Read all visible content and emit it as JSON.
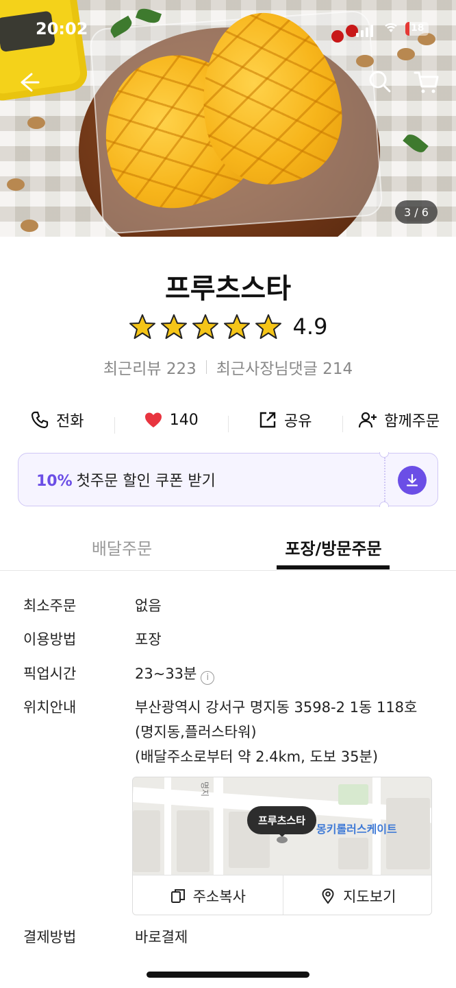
{
  "status_bar": {
    "time": "20:02",
    "battery": "18"
  },
  "hero": {
    "image_counter": "3 / 6"
  },
  "store": {
    "name": "프루츠스타",
    "rating": "4.9",
    "stars": 5,
    "recent_reviews": "최근리뷰 223",
    "owner_replies": "최근사장님댓글 214"
  },
  "actions": {
    "call": "전화",
    "likes": "140",
    "share": "공유",
    "group_order": "함께주문"
  },
  "coupon": {
    "percent": "10%",
    "text": "첫주문 할인 쿠폰 받기"
  },
  "tabs": {
    "delivery": "배달주문",
    "pickup": "포장/방문주문"
  },
  "info": {
    "min_order_label": "최소주문",
    "min_order_value": "없음",
    "method_label": "이용방법",
    "method_value": "포장",
    "pickup_time_label": "픽업시간",
    "pickup_time_value": "23~33분",
    "location_label": "위치안내",
    "address_line1": "부산광역시 강서구 명지동 3598-2 1동 118호",
    "address_line2": "(명지동,플러스타워)",
    "address_line3": "(배달주소로부터 약 2.4km, 도보 35분)",
    "payment_label": "결제방법",
    "payment_value": "바로결제"
  },
  "map": {
    "pin_label": "프루츠스타",
    "poi_label": "몽키롤러스케이트",
    "road_label": "명지",
    "copy_address": "주소복사",
    "view_map": "지도보기"
  },
  "colors": {
    "accent": "#6b4ee6",
    "heart": "#e8343f",
    "star": "#f5c518"
  }
}
